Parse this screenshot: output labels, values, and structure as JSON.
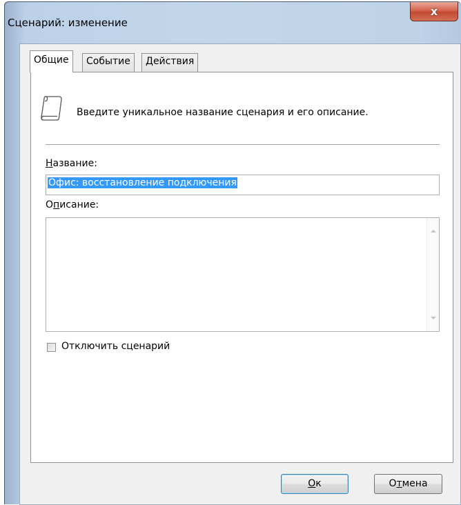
{
  "window": {
    "title": "Сценарий: изменение",
    "close_glyph": "x"
  },
  "tabs": [
    {
      "label": "Общие",
      "active": true
    },
    {
      "label": "Событие",
      "active": false
    },
    {
      "label": "Действия",
      "active": false
    }
  ],
  "panel": {
    "icon": "scroll-icon",
    "intro_text": "Введите уникальное название сценария и его описание.",
    "name_label_accel": "Н",
    "name_label_rest": "азвание:",
    "name_value": "Офис: восстановление подключения",
    "desc_label_first": "О",
    "desc_label_accel": "п",
    "desc_label_rest": "исание:",
    "desc_value": "",
    "disable_label": "Отключить сценарий",
    "disable_checked": false
  },
  "buttons": {
    "ok_accel": "О",
    "ok_rest": "к",
    "cancel_first": "О",
    "cancel_accel": "т",
    "cancel_rest": "мена"
  },
  "colors": {
    "selection": "#3399ff",
    "close_button": "#c24a33"
  }
}
